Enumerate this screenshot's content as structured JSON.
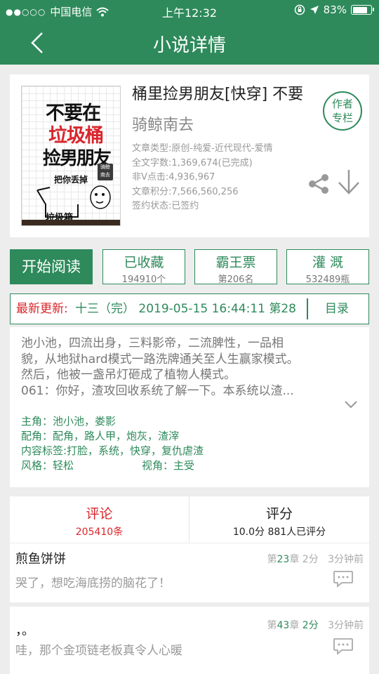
{
  "status_bar": {
    "carrier": "中国电信",
    "time": "上午12:32",
    "battery": "83%",
    "battery_level": 0.83
  },
  "nav": {
    "title": "小说详情",
    "back_icon": "back-arrow-icon"
  },
  "book": {
    "title": "桶里捡男朋友[快穿] 不要",
    "author": "骑鲸南去",
    "author_column": [
      "作者",
      "专栏"
    ],
    "cover": {
      "line1": "不要在",
      "line2": "垃圾桶",
      "line3": "捡男朋友",
      "subtitle": "把你丢掉",
      "bin_label": "垃圾箱",
      "seal": "骑鲸南去"
    },
    "meta": [
      "文章类型:原创-纯爱-近代现代-爱情",
      "全文字数:1,369,674(已完成)",
      "非V点击:4,936,967",
      "文章积分:7,566,560,256",
      "签约状态:已签约"
    ]
  },
  "actions": {
    "start_read": "开始阅读",
    "collected": {
      "label": "已收藏",
      "value": "194910个"
    },
    "ticket": {
      "label": "霸王票",
      "value": "第206名"
    },
    "water": {
      "label": "灌 溉",
      "value": "532489瓶"
    }
  },
  "update": {
    "label": "最新更新:",
    "content": "十三（完） 2019-05-15 16:44:11 第28",
    "catalog": "目录"
  },
  "synopsis": {
    "lines": [
      "池小池，四流出身，三料影帝，二流脾性，一品相",
      "貌，从地狱hard模式一路洗牌通关至人生赢家模式。",
      "然后，他被一盏吊灯砸成了植物人模式。",
      "061：你好，渣攻回收系统了解一下。本系统以渣..."
    ],
    "protagonist": "主角：池小池，娄影",
    "supporting": "配角：配角，路人甲，炮灰，渣滓",
    "tags": "内容标签:打脸，系统，快穿，复仇虐渣",
    "style": "风格：轻松",
    "pov": "视角：主受"
  },
  "comments_header": {
    "reviews_label": "评论",
    "reviews_count": "205410条",
    "score_label": "评分",
    "score_value": "10.0分 881人已评分"
  },
  "comments": [
    {
      "user": "煎鱼饼饼",
      "chapter_pre": "第",
      "chapter_num": "23",
      "chapter_post": "章",
      "score": "2分",
      "time": "3分钟前",
      "text": "哭了，想吃海底捞的脑花了！"
    },
    {
      "user": "，。",
      "chapter_pre": "第",
      "chapter_num": "43",
      "chapter_post": "章",
      "score": "2分",
      "time": "3分钟前",
      "text": "哇，那个金项链老板真令人心暖"
    }
  ],
  "colors": {
    "primary": "#2e8a5b",
    "accent_red": "#d9262c",
    "background": "#ededed"
  }
}
